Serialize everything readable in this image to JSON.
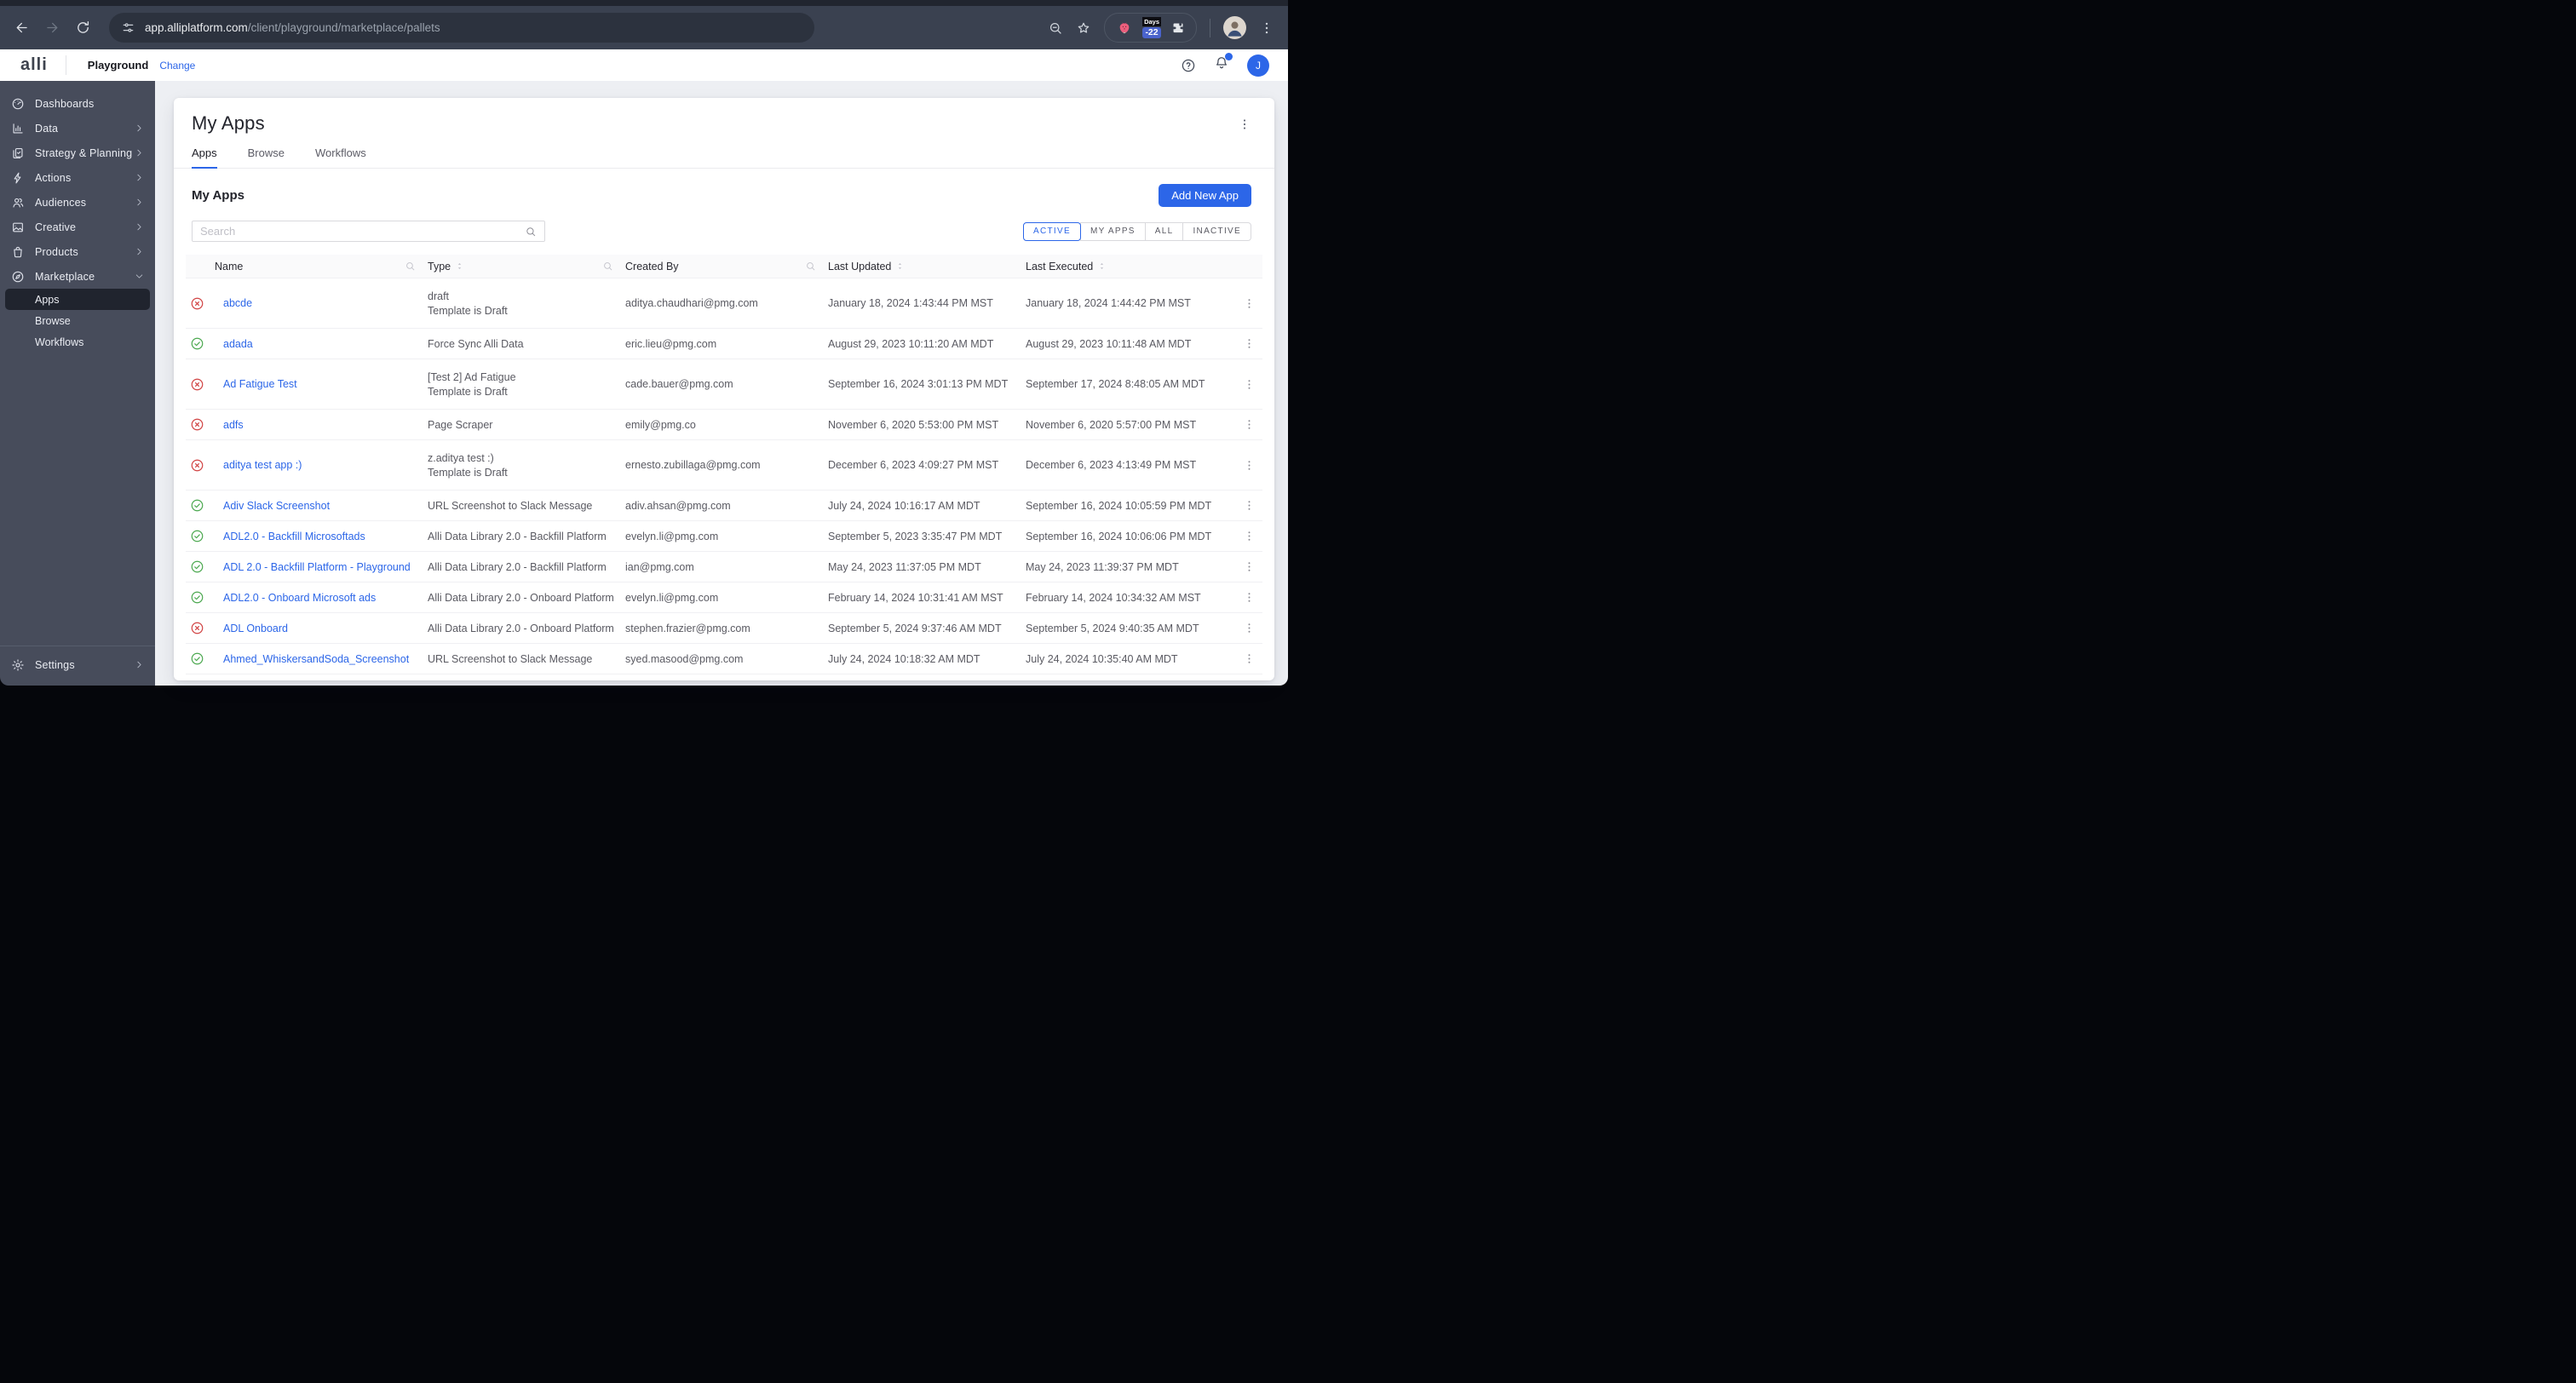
{
  "colors": {
    "accent": "#2C66E8",
    "status_error": "#D14343",
    "status_success": "#4BA84F",
    "sidebar_bg": "#474C5B"
  },
  "browser": {
    "url_host": "app.alliplatform.com",
    "url_path": "/client/playground/marketplace/pallets",
    "days_extension": {
      "label": "Days",
      "value": "-22"
    }
  },
  "header": {
    "logo": "alli",
    "workspace": "Playground",
    "change_label": "Change",
    "avatar_initial": "J"
  },
  "sidebar": {
    "items": [
      {
        "label": "Dashboards",
        "icon": "dashboard",
        "chevron": null,
        "sub": false
      },
      {
        "label": "Data",
        "icon": "data",
        "chevron": "right",
        "sub": false
      },
      {
        "label": "Strategy & Planning",
        "icon": "strategy",
        "chevron": "right",
        "sub": false
      },
      {
        "label": "Actions",
        "icon": "actions",
        "chevron": "right",
        "sub": false
      },
      {
        "label": "Audiences",
        "icon": "audiences",
        "chevron": "right",
        "sub": false
      },
      {
        "label": "Creative",
        "icon": "creative",
        "chevron": "right",
        "sub": false
      },
      {
        "label": "Products",
        "icon": "products",
        "chevron": "right",
        "sub": false
      },
      {
        "label": "Marketplace",
        "icon": "marketplace",
        "chevron": "down",
        "sub": false
      },
      {
        "label": "Apps",
        "sub": true,
        "active": true
      },
      {
        "label": "Browse",
        "sub": true
      },
      {
        "label": "Workflows",
        "sub": true
      }
    ],
    "settings_label": "Settings"
  },
  "main": {
    "page_title": "My Apps",
    "tabs": [
      {
        "label": "Apps",
        "active": true
      },
      {
        "label": "Browse",
        "active": false
      },
      {
        "label": "Workflows",
        "active": false
      }
    ],
    "section_title": "My Apps",
    "add_button_label": "Add New App",
    "search_placeholder": "Search",
    "filters": [
      {
        "label": "ACTIVE",
        "active": true
      },
      {
        "label": "MY APPS",
        "active": false
      },
      {
        "label": "ALL",
        "active": false
      },
      {
        "label": "INACTIVE",
        "active": false
      }
    ],
    "table": {
      "columns": [
        {
          "label": "Name",
          "sort": false,
          "search": true
        },
        {
          "label": "Type",
          "sort": true,
          "search": true
        },
        {
          "label": "Created By",
          "sort": false,
          "search": true
        },
        {
          "label": "Last Updated",
          "sort": true,
          "search": false
        },
        {
          "label": "Last Executed",
          "sort": true,
          "search": false
        }
      ],
      "rows": [
        {
          "status": "error",
          "name": "abcde",
          "type": "draft",
          "type_sub": "Template is Draft",
          "created_by": "aditya.chaudhari@pmg.com",
          "last_updated": "January 18, 2024 1:43:44 PM MST",
          "last_executed": "January 18, 2024 1:44:42 PM MST"
        },
        {
          "status": "success",
          "name": "adada",
          "type": "Force Sync Alli Data",
          "type_sub": "",
          "created_by": "eric.lieu@pmg.com",
          "last_updated": "August 29, 2023 10:11:20 AM MDT",
          "last_executed": "August 29, 2023 10:11:48 AM MDT"
        },
        {
          "status": "error",
          "name": "Ad Fatigue Test",
          "type": "[Test 2] Ad Fatigue",
          "type_sub": "Template is Draft",
          "created_by": "cade.bauer@pmg.com",
          "last_updated": "September 16, 2024 3:01:13 PM MDT",
          "last_executed": "September 17, 2024 8:48:05 AM MDT"
        },
        {
          "status": "error",
          "name": "adfs",
          "type": "Page Scraper",
          "type_sub": "",
          "created_by": "emily@pmg.co",
          "last_updated": "November 6, 2020 5:53:00 PM MST",
          "last_executed": "November 6, 2020 5:57:00 PM MST"
        },
        {
          "status": "error",
          "name": "aditya test app :)",
          "type": "z.aditya test :)",
          "type_sub": "Template is Draft",
          "created_by": "ernesto.zubillaga@pmg.com",
          "last_updated": "December 6, 2023 4:09:27 PM MST",
          "last_executed": "December 6, 2023 4:13:49 PM MST"
        },
        {
          "status": "success",
          "name": "Adiv Slack Screenshot",
          "type": "URL Screenshot to Slack Message",
          "type_sub": "",
          "created_by": "adiv.ahsan@pmg.com",
          "last_updated": "July 24, 2024 10:16:17 AM MDT",
          "last_executed": "September 16, 2024 10:05:59 PM MDT"
        },
        {
          "status": "success",
          "name": "ADL2.0 - Backfill Microsoftads",
          "type": "Alli Data Library 2.0 - Backfill Platform",
          "type_sub": "",
          "created_by": "evelyn.li@pmg.com",
          "last_updated": "September 5, 2023 3:35:47 PM MDT",
          "last_executed": "September 16, 2024 10:06:06 PM MDT"
        },
        {
          "status": "success",
          "name": "ADL 2.0 - Backfill Platform - Playground",
          "type": "Alli Data Library 2.0 - Backfill Platform",
          "type_sub": "",
          "created_by": "ian@pmg.com",
          "last_updated": "May 24, 2023 11:37:05 PM MDT",
          "last_executed": "May 24, 2023 11:39:37 PM MDT"
        },
        {
          "status": "success",
          "name": "ADL2.0 - Onboard Microsoft ads",
          "type": "Alli Data Library 2.0 - Onboard Platform",
          "type_sub": "",
          "created_by": "evelyn.li@pmg.com",
          "last_updated": "February 14, 2024 10:31:41 AM MST",
          "last_executed": "February 14, 2024 10:34:32 AM MST"
        },
        {
          "status": "error",
          "name": "ADL Onboard",
          "type": "Alli Data Library 2.0 - Onboard Platform",
          "type_sub": "",
          "created_by": "stephen.frazier@pmg.com",
          "last_updated": "September 5, 2024 9:37:46 AM MDT",
          "last_executed": "September 5, 2024 9:40:35 AM MDT"
        },
        {
          "status": "success",
          "name": "Ahmed_WhiskersandSoda_Screenshot",
          "type": "URL Screenshot to Slack Message",
          "type_sub": "",
          "created_by": "syed.masood@pmg.com",
          "last_updated": "July 24, 2024 10:18:32 AM MDT",
          "last_executed": "July 24, 2024 10:35:40 AM MDT"
        }
      ]
    }
  }
}
